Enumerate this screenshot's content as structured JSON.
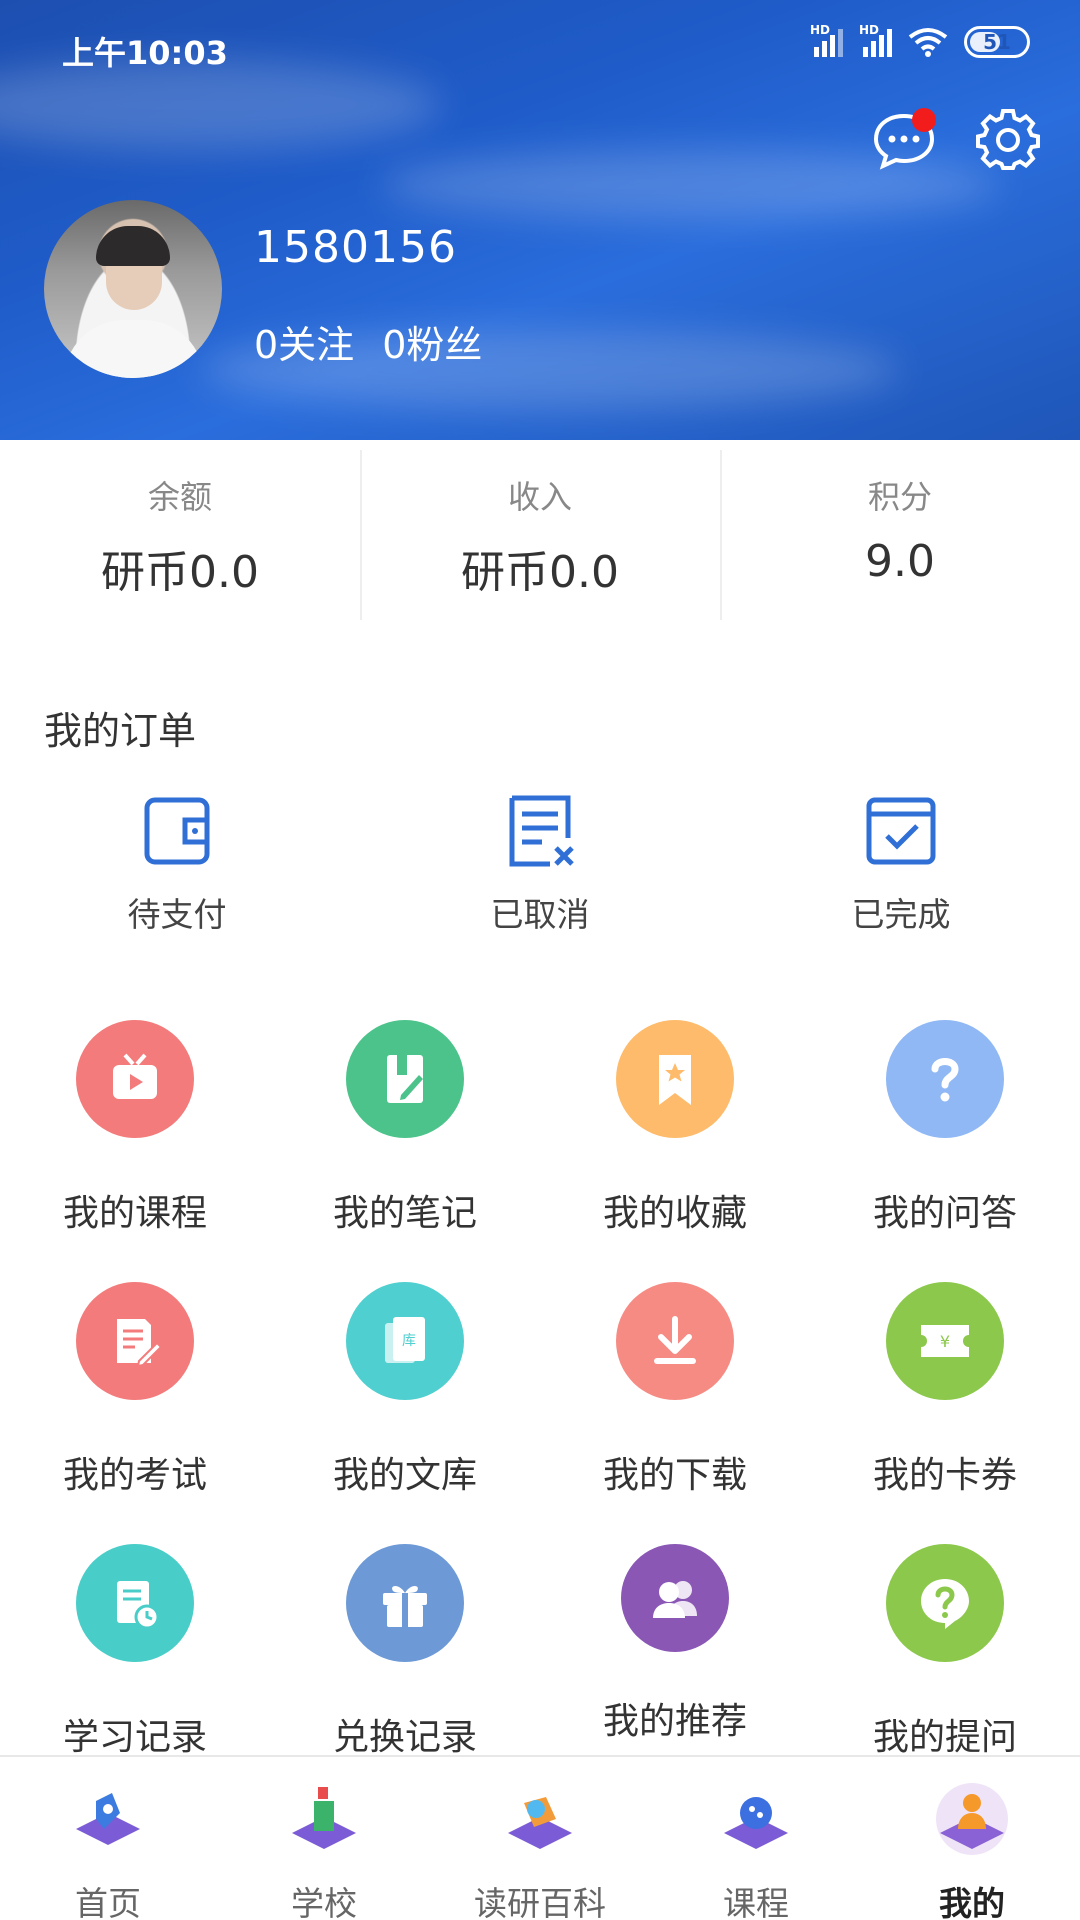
{
  "status_bar": {
    "time": "上午10:03",
    "battery": "51"
  },
  "profile": {
    "username": "1580156",
    "following": "0关注",
    "fans": "0粉丝"
  },
  "stats": [
    {
      "label": "余额",
      "value": "研币0.0"
    },
    {
      "label": "收入",
      "value": "研币0.0"
    },
    {
      "label": "积分",
      "value": "9.0"
    }
  ],
  "orders": {
    "title": "我的订单",
    "items": [
      {
        "label": "待支付",
        "icon": "wallet-icon"
      },
      {
        "label": "已取消",
        "icon": "cancelled-doc-icon"
      },
      {
        "label": "已完成",
        "icon": "calendar-check-icon"
      }
    ]
  },
  "grid": [
    {
      "label": "我的课程",
      "icon": "tv-play-icon",
      "color": "#f37b7b"
    },
    {
      "label": "我的笔记",
      "icon": "notebook-pen-icon",
      "color": "#4cc38a"
    },
    {
      "label": "我的收藏",
      "icon": "bookmark-star-icon",
      "color": "#fdbb6b"
    },
    {
      "label": "我的问答",
      "icon": "question-icon",
      "color": "#8fb8f5"
    },
    {
      "label": "我的考试",
      "icon": "exam-pen-icon",
      "color": "#f37b7b"
    },
    {
      "label": "我的文库",
      "icon": "library-book-icon",
      "color": "#4fcfcf"
    },
    {
      "label": "我的下载",
      "icon": "download-icon",
      "color": "#f68b84"
    },
    {
      "label": "我的卡券",
      "icon": "coupon-icon",
      "color": "#8cc84b"
    },
    {
      "label": "学习记录",
      "icon": "study-record-icon",
      "color": "#49cdc8"
    },
    {
      "label": "兑换记录",
      "icon": "gift-icon",
      "color": "#6d9ad6"
    },
    {
      "label": "我的推荐",
      "icon": "users-icon",
      "color": "#8a57b5"
    },
    {
      "label": "我的提问",
      "icon": "question-bubble-icon",
      "color": "#8cc84b"
    }
  ],
  "tabs": [
    {
      "label": "首页",
      "icon": "home-tab-icon",
      "active": false
    },
    {
      "label": "学校",
      "icon": "school-tab-icon",
      "active": false
    },
    {
      "label": "读研百科",
      "icon": "encyclopedia-tab-icon",
      "active": false
    },
    {
      "label": "课程",
      "icon": "course-tab-icon",
      "active": false
    },
    {
      "label": "我的",
      "icon": "profile-tab-icon",
      "active": true
    }
  ],
  "colors": {
    "header_blue": "#1f5cc9",
    "accent_blue": "#2f6fd6",
    "notification_red": "#f21c1c"
  }
}
